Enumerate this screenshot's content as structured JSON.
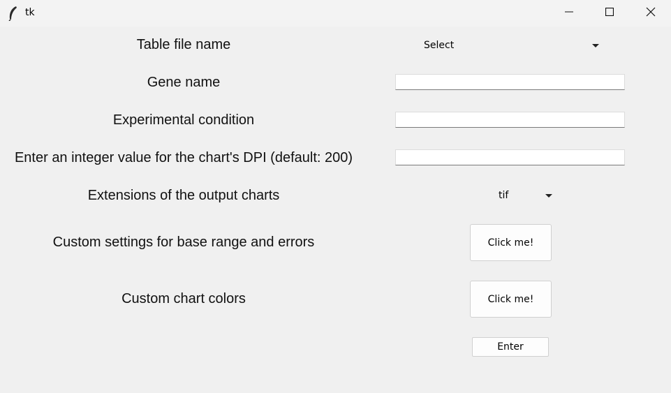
{
  "window": {
    "title": "tk"
  },
  "form": {
    "table_file_label": "Table file name",
    "table_file_selected": "Select",
    "gene_name_label": "Gene name",
    "gene_name_value": "",
    "condition_label": "Experimental condition",
    "condition_value": "",
    "dpi_label": "Enter an integer value for the chart's DPI (default: 200)",
    "dpi_value": "",
    "extensions_label": "Extensions of the output charts",
    "extensions_selected": "tif",
    "custom_range_label": "Custom settings for base range and errors",
    "custom_range_button": "Click me!",
    "custom_colors_label": "Custom chart colors",
    "custom_colors_button": "Click me!",
    "enter_button": "Enter"
  },
  "icons": {
    "app": "tk-feather-icon",
    "minimize": "minimize-icon",
    "maximize": "maximize-icon",
    "close": "close-icon"
  }
}
